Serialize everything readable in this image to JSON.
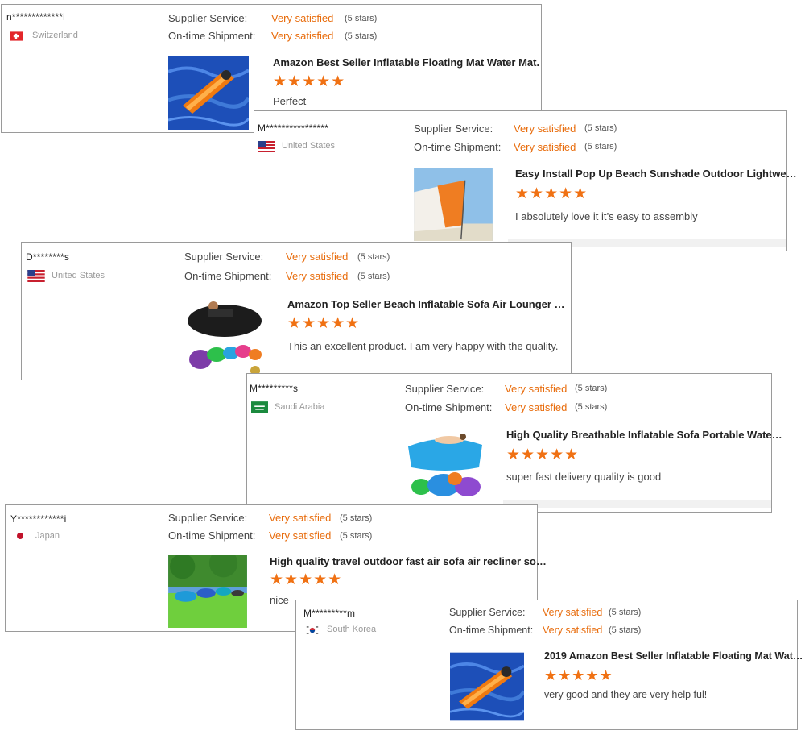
{
  "colors": {
    "accent": "#e86c0c",
    "star": "#f07113",
    "border": "#9a9a9a"
  },
  "reviews": [
    {
      "buyer": "n*************i",
      "country": "Switzerland",
      "flag_icon": "switzerland-flag-icon",
      "supplier_service_label": "Supplier Service:",
      "supplier_service_value": "Very satisfied",
      "supplier_service_stars": "(5 stars)",
      "shipment_label": "On-time Shipment:",
      "shipment_value": "Very satisfied",
      "shipment_stars": "(5 stars)",
      "product": "Amazon Best Seller Inflatable Floating Mat Water Mat.",
      "rating_stars": "★★★★★",
      "comment": "Perfect",
      "thumb_icon": "floating-mat-pool-thumbnail"
    },
    {
      "buyer": "M****************",
      "country": "United States",
      "flag_icon": "usa-flag-icon",
      "supplier_service_label": "Supplier Service:",
      "supplier_service_value": "Very satisfied",
      "supplier_service_stars": "(5 stars)",
      "shipment_label": "On-time Shipment:",
      "shipment_value": "Very satisfied",
      "shipment_stars": "(5 stars)",
      "product": "Easy Install Pop Up Beach Sunshade Outdoor Lightwe…",
      "rating_stars": "★★★★★",
      "comment": "I absolutely love it it’s easy to assembly",
      "thumb_icon": "beach-sunshade-thumbnail"
    },
    {
      "buyer": "D********s",
      "country": "United States",
      "flag_icon": "usa-flag-icon",
      "supplier_service_label": "Supplier Service:",
      "supplier_service_value": "Very satisfied",
      "supplier_service_stars": "(5 stars)",
      "shipment_label": "On-time Shipment:",
      "shipment_value": "Very satisfied",
      "shipment_stars": "(5 stars)",
      "product": "Amazon Top Seller Beach Inflatable Sofa Air Lounger …",
      "rating_stars": "★★★★★",
      "comment": "This an excellent product.  I am very happy with the quality.",
      "thumb_icon": "air-lounger-thumbnail"
    },
    {
      "buyer": "M*********s",
      "country": "Saudi Arabia",
      "flag_icon": "saudi-arabia-flag-icon",
      "supplier_service_label": "Supplier Service:",
      "supplier_service_value": "Very satisfied",
      "supplier_service_stars": "(5 stars)",
      "shipment_label": "On-time Shipment:",
      "shipment_value": "Very satisfied",
      "shipment_stars": "(5 stars)",
      "product": "High Quality Breathable Inflatable Sofa Portable Wate…",
      "rating_stars": "★★★★★",
      "comment": "super fast delivery quality is good",
      "thumb_icon": "inflatable-sofa-thumbnail"
    },
    {
      "buyer": "Y************i",
      "country": "Japan",
      "flag_icon": "japan-flag-icon",
      "supplier_service_label": "Supplier Service:",
      "supplier_service_value": "Very satisfied",
      "supplier_service_stars": "(5 stars)",
      "shipment_label": "On-time Shipment:",
      "shipment_value": "Very satisfied",
      "shipment_stars": "(5 stars)",
      "product": "High quality travel outdoor fast air sofa air recliner so…",
      "rating_stars": "★★★★★",
      "comment": "nice",
      "thumb_icon": "air-sofa-grass-thumbnail"
    },
    {
      "buyer": "M*********m",
      "country": "South Korea",
      "flag_icon": "south-korea-flag-icon",
      "supplier_service_label": "Supplier Service:",
      "supplier_service_value": "Very satisfied",
      "supplier_service_stars": "(5 stars)",
      "shipment_label": "On-time Shipment:",
      "shipment_value": "Very satisfied",
      "shipment_stars": "(5 stars)",
      "product": "2019 Amazon Best Seller Inflatable Floating Mat Wat…",
      "rating_stars": "★★★★★",
      "comment": "very good and they are very help ful!",
      "thumb_icon": "floating-mat-pool-thumbnail"
    }
  ]
}
